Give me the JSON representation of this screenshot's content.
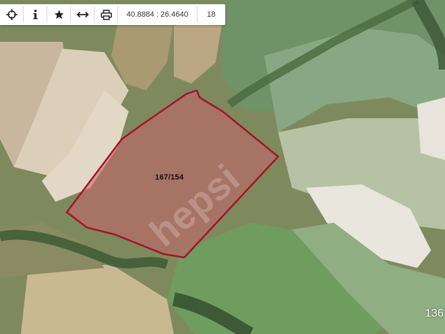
{
  "toolbar": {
    "tools": [
      {
        "icon": "crosshair-icon"
      },
      {
        "icon": "info-icon"
      },
      {
        "icon": "star-icon"
      },
      {
        "icon": "measure-icon"
      },
      {
        "icon": "print-icon"
      }
    ],
    "coordinates": "40.8884 : 26.4640",
    "zoom_level": "18"
  },
  "map": {
    "parcel_label": "167/154",
    "edge_label": "136",
    "watermark": "hepsi",
    "parcel_fill": "#c8616a",
    "parcel_stroke": "#a3132a"
  }
}
